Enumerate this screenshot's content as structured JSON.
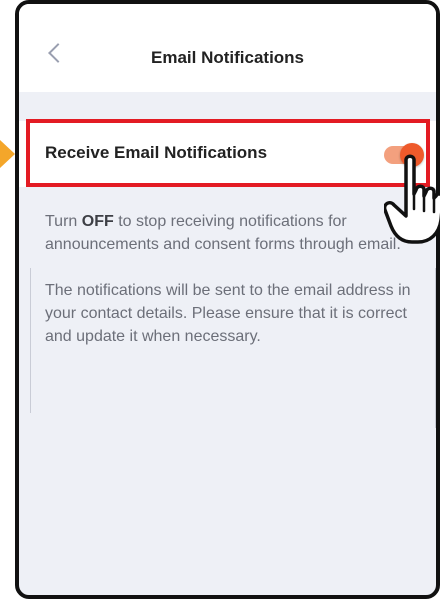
{
  "header": {
    "title": "Email Notifications"
  },
  "setting": {
    "label": "Receive Email Notifications",
    "enabled": true,
    "toggle_color": "#ee5a2b"
  },
  "description": {
    "p1_prefix": "Turn ",
    "p1_bold": "OFF",
    "p1_suffix": " to stop receiving notifications for announcements and consent forms through email.",
    "p2": "The notifications will be sent to the email address in your contact details. Please ensure that it is correct and update it when necessary."
  },
  "annotation": {
    "highlight_color": "#e31b23",
    "arrow_color": "#f4a62a",
    "pointer": "hand-pointer-icon"
  }
}
